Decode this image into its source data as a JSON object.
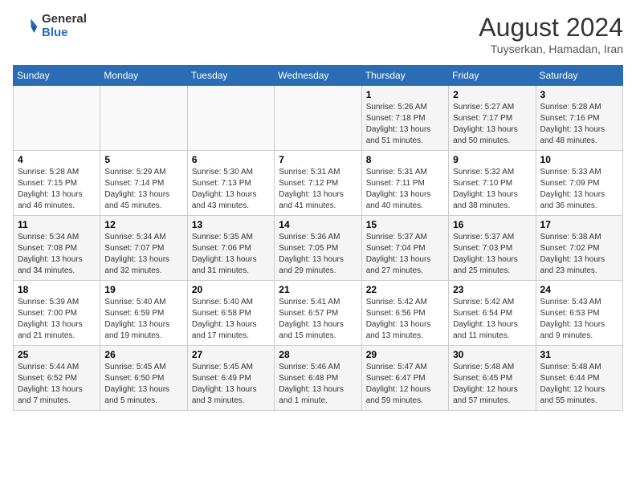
{
  "logo": {
    "general": "General",
    "blue": "Blue"
  },
  "title": {
    "month_year": "August 2024",
    "location": "Tuyserkan, Hamadan, Iran"
  },
  "weekdays": [
    "Sunday",
    "Monday",
    "Tuesday",
    "Wednesday",
    "Thursday",
    "Friday",
    "Saturday"
  ],
  "weeks": [
    [
      {
        "day": "",
        "info": ""
      },
      {
        "day": "",
        "info": ""
      },
      {
        "day": "",
        "info": ""
      },
      {
        "day": "",
        "info": ""
      },
      {
        "day": "1",
        "info": "Sunrise: 5:26 AM\nSunset: 7:18 PM\nDaylight: 13 hours\nand 51 minutes."
      },
      {
        "day": "2",
        "info": "Sunrise: 5:27 AM\nSunset: 7:17 PM\nDaylight: 13 hours\nand 50 minutes."
      },
      {
        "day": "3",
        "info": "Sunrise: 5:28 AM\nSunset: 7:16 PM\nDaylight: 13 hours\nand 48 minutes."
      }
    ],
    [
      {
        "day": "4",
        "info": "Sunrise: 5:28 AM\nSunset: 7:15 PM\nDaylight: 13 hours\nand 46 minutes."
      },
      {
        "day": "5",
        "info": "Sunrise: 5:29 AM\nSunset: 7:14 PM\nDaylight: 13 hours\nand 45 minutes."
      },
      {
        "day": "6",
        "info": "Sunrise: 5:30 AM\nSunset: 7:13 PM\nDaylight: 13 hours\nand 43 minutes."
      },
      {
        "day": "7",
        "info": "Sunrise: 5:31 AM\nSunset: 7:12 PM\nDaylight: 13 hours\nand 41 minutes."
      },
      {
        "day": "8",
        "info": "Sunrise: 5:31 AM\nSunset: 7:11 PM\nDaylight: 13 hours\nand 40 minutes."
      },
      {
        "day": "9",
        "info": "Sunrise: 5:32 AM\nSunset: 7:10 PM\nDaylight: 13 hours\nand 38 minutes."
      },
      {
        "day": "10",
        "info": "Sunrise: 5:33 AM\nSunset: 7:09 PM\nDaylight: 13 hours\nand 36 minutes."
      }
    ],
    [
      {
        "day": "11",
        "info": "Sunrise: 5:34 AM\nSunset: 7:08 PM\nDaylight: 13 hours\nand 34 minutes."
      },
      {
        "day": "12",
        "info": "Sunrise: 5:34 AM\nSunset: 7:07 PM\nDaylight: 13 hours\nand 32 minutes."
      },
      {
        "day": "13",
        "info": "Sunrise: 5:35 AM\nSunset: 7:06 PM\nDaylight: 13 hours\nand 31 minutes."
      },
      {
        "day": "14",
        "info": "Sunrise: 5:36 AM\nSunset: 7:05 PM\nDaylight: 13 hours\nand 29 minutes."
      },
      {
        "day": "15",
        "info": "Sunrise: 5:37 AM\nSunset: 7:04 PM\nDaylight: 13 hours\nand 27 minutes."
      },
      {
        "day": "16",
        "info": "Sunrise: 5:37 AM\nSunset: 7:03 PM\nDaylight: 13 hours\nand 25 minutes."
      },
      {
        "day": "17",
        "info": "Sunrise: 5:38 AM\nSunset: 7:02 PM\nDaylight: 13 hours\nand 23 minutes."
      }
    ],
    [
      {
        "day": "18",
        "info": "Sunrise: 5:39 AM\nSunset: 7:00 PM\nDaylight: 13 hours\nand 21 minutes."
      },
      {
        "day": "19",
        "info": "Sunrise: 5:40 AM\nSunset: 6:59 PM\nDaylight: 13 hours\nand 19 minutes."
      },
      {
        "day": "20",
        "info": "Sunrise: 5:40 AM\nSunset: 6:58 PM\nDaylight: 13 hours\nand 17 minutes."
      },
      {
        "day": "21",
        "info": "Sunrise: 5:41 AM\nSunset: 6:57 PM\nDaylight: 13 hours\nand 15 minutes."
      },
      {
        "day": "22",
        "info": "Sunrise: 5:42 AM\nSunset: 6:56 PM\nDaylight: 13 hours\nand 13 minutes."
      },
      {
        "day": "23",
        "info": "Sunrise: 5:42 AM\nSunset: 6:54 PM\nDaylight: 13 hours\nand 11 minutes."
      },
      {
        "day": "24",
        "info": "Sunrise: 5:43 AM\nSunset: 6:53 PM\nDaylight: 13 hours\nand 9 minutes."
      }
    ],
    [
      {
        "day": "25",
        "info": "Sunrise: 5:44 AM\nSunset: 6:52 PM\nDaylight: 13 hours\nand 7 minutes."
      },
      {
        "day": "26",
        "info": "Sunrise: 5:45 AM\nSunset: 6:50 PM\nDaylight: 13 hours\nand 5 minutes."
      },
      {
        "day": "27",
        "info": "Sunrise: 5:45 AM\nSunset: 6:49 PM\nDaylight: 13 hours\nand 3 minutes."
      },
      {
        "day": "28",
        "info": "Sunrise: 5:46 AM\nSunset: 6:48 PM\nDaylight: 13 hours\nand 1 minute."
      },
      {
        "day": "29",
        "info": "Sunrise: 5:47 AM\nSunset: 6:47 PM\nDaylight: 12 hours\nand 59 minutes."
      },
      {
        "day": "30",
        "info": "Sunrise: 5:48 AM\nSunset: 6:45 PM\nDaylight: 12 hours\nand 57 minutes."
      },
      {
        "day": "31",
        "info": "Sunrise: 5:48 AM\nSunset: 6:44 PM\nDaylight: 12 hours\nand 55 minutes."
      }
    ]
  ]
}
